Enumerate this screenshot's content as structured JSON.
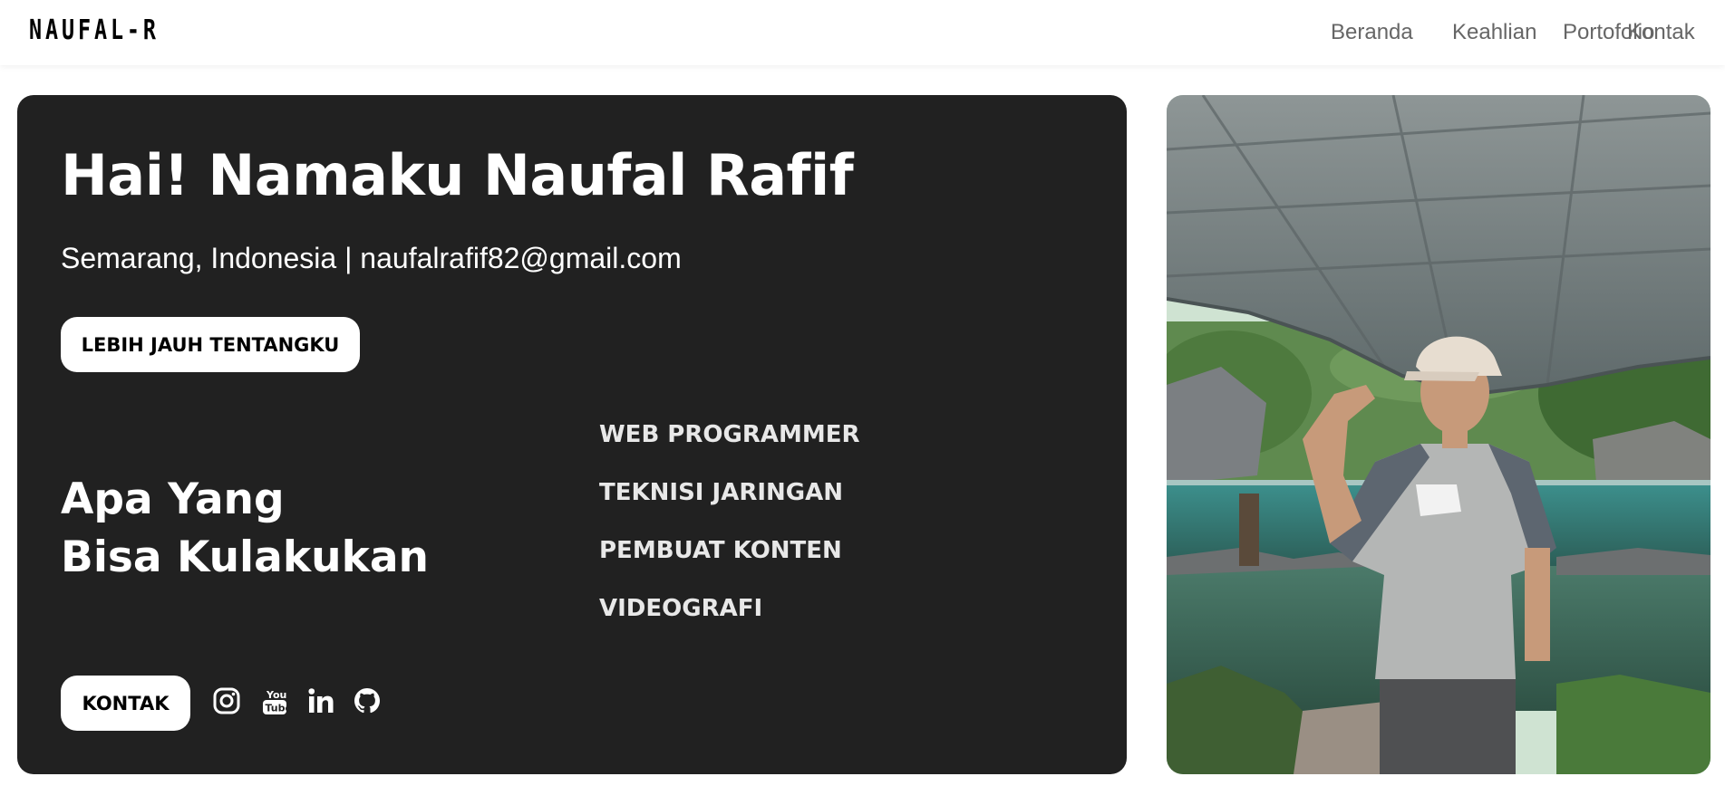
{
  "navbar": {
    "logo": "NAUFAL-R",
    "links": [
      "Beranda",
      "Keahlian",
      "Portofolio",
      "Kontak"
    ]
  },
  "hero": {
    "title": "Hai! Namaku Naufal Rafif",
    "subtitle": "Semarang, Indonesia | naufalrafif82@gmail.com",
    "about_button": "LEBIH JAUH TENTANGKU",
    "heading_line1": "Apa Yang",
    "heading_line2": "Bisa Kulakukan",
    "skills": [
      "WEB PROGRAMMER",
      "TEKNISI JARINGAN",
      "PEMBUAT KONTEN",
      "VIDEOGRAFI"
    ],
    "contact_button": "KONTAK",
    "social_icons": [
      "instagram-icon",
      "youtube-icon",
      "linkedin-icon",
      "github-icon"
    ]
  },
  "photo": {
    "icon": "profile-photo"
  },
  "colors": {
    "card_bg": "#212121",
    "text_on_card": "#ffffff",
    "nav_link": "#666666",
    "page_bg": "#ffffff"
  }
}
